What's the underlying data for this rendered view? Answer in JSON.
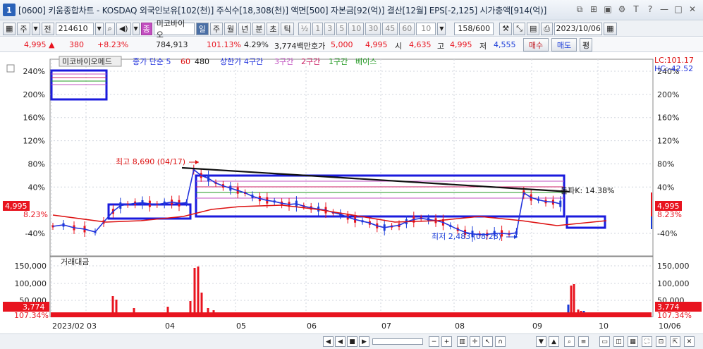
{
  "window": {
    "badge": "1",
    "title": "[0600] 키움종합차트 - KOSDAQ 외국인보유[102(천)] 주식수[18,308(천)] 액면[500] 자본금[92(억)] 결산[12월] EPS[-2,125] 시가총액[914(억)]",
    "icons": [
      "restore-icon",
      "pin-icon",
      "copy-icon",
      "settings-icon",
      "text-icon",
      "help-icon",
      "minimize-icon",
      "maximize-icon",
      "close-icon"
    ]
  },
  "toolbar": {
    "period_label": "주",
    "jeon_label": "전",
    "code": "214610",
    "stock_chip": "종",
    "stock_name": "미코바이오",
    "day": "일",
    "week": "주",
    "month": "월",
    "year": "년",
    "minute": "분",
    "second": "초",
    "tick": "틱",
    "fraction": "½",
    "n1": "1",
    "n3": "3",
    "n5": "5",
    "n10": "10",
    "n30": "30",
    "n45": "45",
    "n60": "60",
    "period_value": "10",
    "count": "158/600",
    "date": "2023/10/06"
  },
  "quote": {
    "price": "4,995",
    "change": "380",
    "change_pct": "+8.23%",
    "volume": "784,913",
    "vol_ratio": "101.13%",
    "turnover": "4.29%",
    "amount": "3,774백만",
    "ask_label": "호가",
    "ask": "5,000",
    "bid": "4,995",
    "open_label": "시",
    "open": "4,635",
    "high_label": "고",
    "high": "4,995",
    "low_label": "저",
    "low": "4,555",
    "buy": "매수",
    "sell": "매도",
    "avg": "평"
  },
  "colors": {
    "up": "#e8141f",
    "down": "#1a3cd8",
    "grid": "#c9cfd8"
  },
  "chart_data": [
    {
      "type": "line",
      "title": "미코바이오메드",
      "series": [
        {
          "name": "종가 단순 5",
          "color": "#2233dd"
        },
        {
          "name": "60",
          "color": "#dd1111"
        },
        {
          "name": "480",
          "color": "#111111"
        }
      ],
      "overlays": [
        "상한가 4구간",
        "3구간",
        "2구간",
        "1구간",
        "베이스"
      ],
      "y_labels": [
        "240%",
        "200%",
        "160%",
        "120%",
        "80%",
        "40%",
        "-40%"
      ],
      "x_labels": [
        "2023/02",
        "03",
        "04",
        "05",
        "06",
        "07",
        "08",
        "09",
        "10"
      ],
      "annotations": {
        "high": "최고 8,690 (04/17)",
        "low": "최저 2,483 (08/28)",
        "lc": "LC:101.17",
        "hc": "HC:-42.52",
        "trend": "돌파K: 14.38%"
      },
      "last_value": "4,995",
      "last_pct": "8.23%",
      "close_path": [
        [
          -4,
          -6
        ],
        [
          -3,
          -8
        ],
        [
          -2,
          -7
        ],
        [
          -1,
          -9
        ],
        [
          0,
          -12
        ],
        [
          1,
          -2
        ],
        [
          2,
          8
        ],
        [
          3,
          10
        ],
        [
          4,
          12
        ],
        [
          5,
          13
        ],
        [
          6,
          11
        ],
        [
          7,
          10
        ],
        [
          8,
          12
        ],
        [
          9,
          14
        ],
        [
          10,
          12
        ],
        [
          11,
          13
        ],
        [
          12,
          70
        ],
        [
          13,
          60
        ],
        [
          14,
          55
        ],
        [
          15,
          47
        ],
        [
          16,
          42
        ],
        [
          17,
          38
        ],
        [
          18,
          34
        ],
        [
          19,
          30
        ],
        [
          20,
          24
        ],
        [
          21,
          20
        ],
        [
          22,
          17
        ],
        [
          23,
          15
        ],
        [
          24,
          12
        ],
        [
          25,
          10
        ],
        [
          26,
          11
        ],
        [
          27,
          7
        ],
        [
          28,
          4
        ],
        [
          29,
          2
        ],
        [
          30,
          0
        ],
        [
          31,
          -4
        ],
        [
          32,
          -7
        ],
        [
          33,
          -12
        ],
        [
          34,
          -16
        ],
        [
          35,
          -19
        ],
        [
          36,
          -22
        ],
        [
          37,
          -27
        ],
        [
          38,
          -30
        ],
        [
          39,
          -28
        ],
        [
          40,
          -26
        ],
        [
          41,
          -20
        ],
        [
          42,
          -16
        ],
        [
          43,
          -14
        ],
        [
          44,
          -16
        ],
        [
          45,
          -18
        ],
        [
          46,
          -21
        ],
        [
          47,
          -27
        ],
        [
          48,
          -33
        ],
        [
          49,
          -38
        ],
        [
          50,
          -41
        ],
        [
          51,
          -42
        ],
        [
          52,
          -42
        ],
        [
          53,
          -40
        ],
        [
          54,
          -40
        ],
        [
          55,
          -41
        ],
        [
          56,
          -39
        ],
        [
          57,
          30
        ],
        [
          58,
          22
        ],
        [
          59,
          18
        ],
        [
          60,
          15
        ],
        [
          61,
          14
        ],
        [
          62,
          11
        ]
      ]
    },
    {
      "type": "bar",
      "title": "거래대금",
      "y_labels": [
        "150,000",
        "100,000",
        "50,000"
      ],
      "last_value": "3,774",
      "last_pct": "107.34%",
      "x_end_label": "10/06"
    }
  ]
}
